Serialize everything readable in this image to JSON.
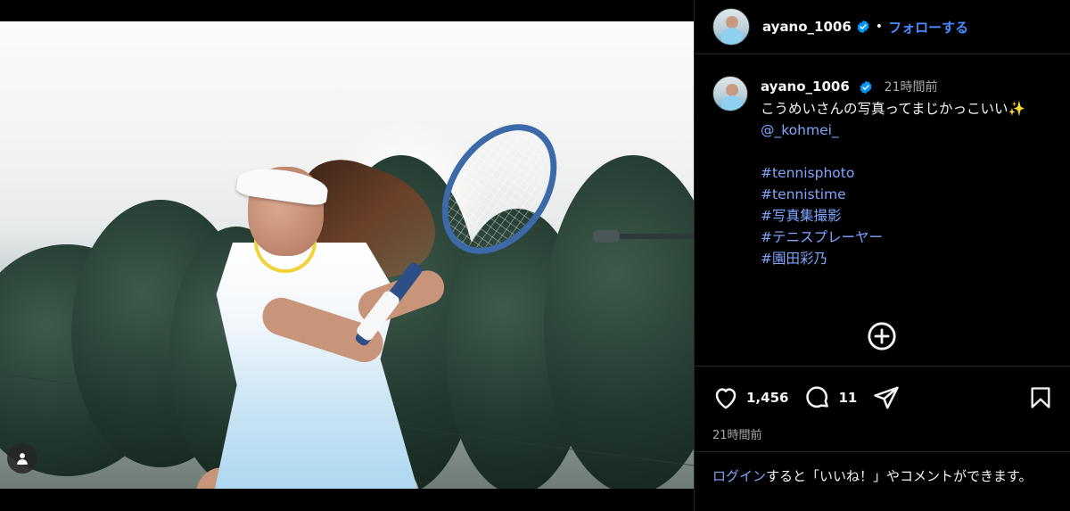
{
  "post": {
    "username": "ayano_1006",
    "follow_label": "フォローする",
    "dot": "•",
    "icons": {
      "verified": "verified-badge-icon",
      "user_tag": "user-tag-icon",
      "more": "add-circle-icon",
      "like": "heart-icon",
      "comment": "comment-icon",
      "share": "send-icon",
      "save": "bookmark-icon"
    }
  },
  "caption": {
    "username": "ayano_1006",
    "time": "21時間前",
    "text": "こうめいさんの写真ってまじかっこいい✨",
    "mention": "@_kohmei_",
    "hashtags": [
      "#tennisphoto",
      "#tennistime",
      "#写真集撮影",
      "#テニスプレーヤー",
      "#園田彩乃"
    ]
  },
  "stats": {
    "likes": "1,456",
    "comments": "11",
    "posted": "21時間前"
  },
  "login": {
    "link": "ログイン",
    "rest": "すると「いいね！」やコメントができます。"
  },
  "colors": {
    "background": "#000000",
    "text": "#f5f5f5",
    "secondary": "#a8a8a8",
    "link": "#7fa6ff",
    "follow": "#4a8cff",
    "border": "#262626",
    "verified": "#0095f6"
  }
}
